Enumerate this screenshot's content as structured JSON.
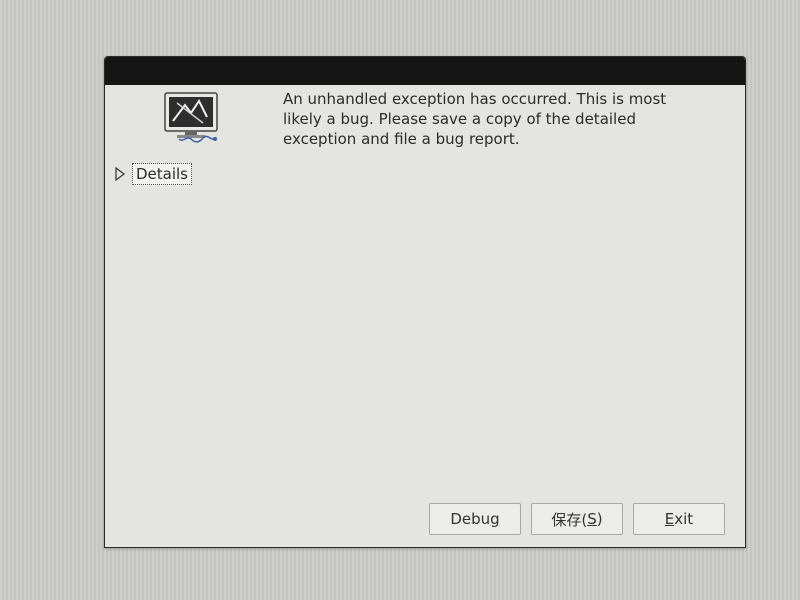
{
  "dialog": {
    "message": "An unhandled exception has occurred.  This is most likely a bug.  Please save a copy of the detailed exception and file a bug report.",
    "details_label": "Details",
    "icon": "crashed-computer-icon",
    "expander_icon": "triangle-right-icon"
  },
  "buttons": {
    "debug": {
      "pre": "Debu",
      "mnemonic": "g",
      "post": ""
    },
    "save": {
      "pre": "保存(",
      "mnemonic": "S",
      "post": ")"
    },
    "exit": {
      "pre": "",
      "mnemonic": "E",
      "post": "xit"
    }
  }
}
